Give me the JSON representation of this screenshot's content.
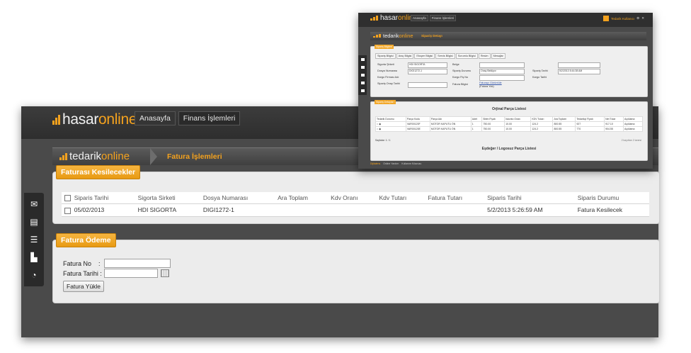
{
  "main": {
    "logo": {
      "part1": "hasar",
      "part2": "online"
    },
    "nav": [
      "Anasayfa",
      "Finans İşlemleri"
    ],
    "sub_logo": {
      "part1": "tedarik",
      "part2": "online"
    },
    "sub_title": "Fatura İşlemleri",
    "fatura_panel": {
      "title": "Faturası Kesilecekler",
      "columns": [
        "Siparis Tarihi",
        "Sigorta Sirketi",
        "Dosya Numarası",
        "Ara Toplam",
        "Kdv Oranı",
        "Kdv Tutarı",
        "Fatura Tutarı",
        "Siparis Tarihi",
        "Siparis Durumu"
      ],
      "rows": [
        [
          "05/02/2013",
          "HDI SIGORTA",
          "DIGI1272-1",
          "",
          "",
          "",
          "",
          "5/2/2013 5:26:59 AM",
          "Fatura Kesilecek"
        ]
      ]
    },
    "odeme_panel": {
      "title": "Fatura Ödeme",
      "fatura_no_label": "Fatura No",
      "fatura_tarihi_label": "Fatura Tarihi",
      "colon": ":",
      "fatura_no_value": "",
      "fatura_tarihi_value": "",
      "button": "Fatura Yükle"
    },
    "dock_icons": [
      "mail-icon",
      "document-icon",
      "list-icon",
      "book-icon",
      "chart-icon"
    ]
  },
  "overlay": {
    "logo": {
      "part1": "hasar",
      "part2": "online"
    },
    "nav": [
      "Anasayfa",
      "Finans İşlemleri"
    ],
    "user_name": "Tedarik Kullanıcı",
    "sub_logo": {
      "part1": "tedarik",
      "part2": "online"
    },
    "sub_title": "Sipariş Detayı",
    "siparis_panel": {
      "title": "Sipariş Bilgileri",
      "tabs": [
        "Sipariş Bilgisi",
        "Araç Bilgisi",
        "Eksper Bilgisi",
        "Servis Bilgisi",
        "Sorumlu Bilgisi",
        "Resim",
        "Mesajlar"
      ],
      "fields": {
        "sigorta_label": "Sigorta Şirketi",
        "sigorta_value": "HDI SIGORTA",
        "dosya_label": "Dosya Numarası",
        "dosya_value": "DIGI1272-1",
        "kargo_firmasi_label": "Kargo Firması Adı",
        "siparis_onay_label": "Sipariş Onay Tarihi",
        "belge_label": "Belge",
        "siparis_durumu_label": "Sipariş Durumu",
        "siparis_durumu_value": "Onay Bekliyor",
        "kargo_fis_label": "Kargo Fiş No",
        "fatura_label": "Fatura Bilgisi",
        "fatura_link": "Faturayı Görüntüle",
        "fatura_note": "(Fatura Yok)",
        "siparis_tarih_label": "Sipariş Tarihi",
        "siparis_tarih_value": "5/2/2013 5:44:38 AM",
        "kargo_tarihi_label": "Kargo Tarihi"
      }
    },
    "parca_panel": {
      "tag": "Sipariş Detayları",
      "orjinal_title": "Orjinal Parça Listesi",
      "columns": [
        "Tedarik Durumu",
        "Parça Kodu",
        "Parça Adı",
        "Adet",
        "Birim Fiyatı",
        "İskonto Oranı",
        "KDV Tutarı",
        "Ara Toplam",
        "Tedarikçi Fiyatı",
        "Net Tutar",
        "Açıklama"
      ],
      "rows": [
        [
          "VAR00120F",
          "MOTOR KAPUTU ÖN",
          "1",
          "750.00",
          "10.00",
          "124.2",
          "800.55",
          "927",
          "917.10",
          "Açıklama"
        ],
        [
          "VAR00120E",
          "MOTOR KAPUTU ÖN",
          "1",
          "750.00",
          "10.00",
          "124.2",
          "800.55",
          "770",
          "904.55",
          "Açıklama"
        ]
      ],
      "pager": "Sayfalar: 1 / 1",
      "kayit": "2 kayıttan 2 tanesi",
      "esdeger_title": "Eşdeğer / Logosuz Parça Listesi"
    },
    "footer": [
      "Dijitalens",
      "Online Yardım",
      "Kullanım Kılavuzu"
    ]
  }
}
